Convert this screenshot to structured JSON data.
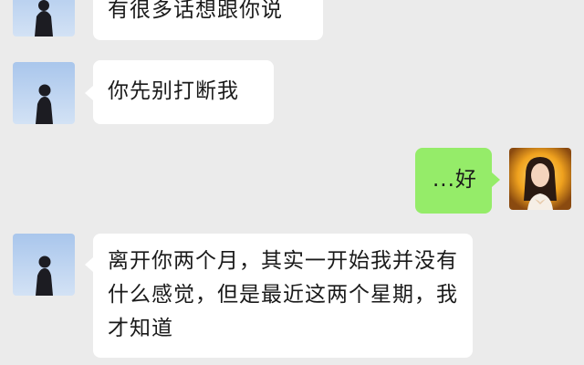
{
  "chat": {
    "messages": [
      {
        "side": "received",
        "avatar": "boy-silhouette-avatar",
        "text": "有很多话想跟你说"
      },
      {
        "side": "received",
        "avatar": "boy-silhouette-avatar",
        "text": "你先别打断我"
      },
      {
        "side": "sent",
        "avatar": "girl-portrait-avatar",
        "text": "...好"
      },
      {
        "side": "received",
        "avatar": "boy-silhouette-avatar",
        "text": "离开你两个月，其实一开始我并没有什么感觉，但是最近这两个星期，我才知道"
      }
    ]
  },
  "colors": {
    "background": "#ebebeb",
    "received_bubble": "#ffffff",
    "sent_bubble": "#95ec69",
    "text": "#1a1a1a"
  }
}
